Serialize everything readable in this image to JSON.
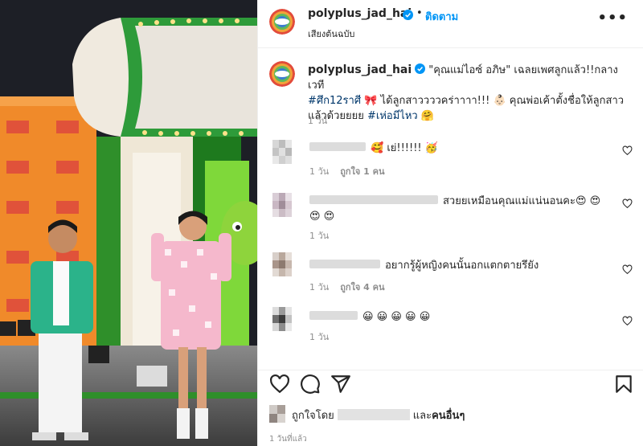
{
  "post": {
    "username": "polyplus_jad_hai",
    "separator": "•",
    "follow_label": "ติดตาม",
    "audio_label": "เสียงต้นฉบับ",
    "more_label": "•••"
  },
  "caption": {
    "username": "polyplus_jad_hai",
    "text_1": " \"คุณแม่ไอซ์ อภิษ\" เฉลยเพศลูกแล้ว!!กลางเวที",
    "hashtag_1": "#ศึก12ราศี",
    "text_2": " 🎀  ได้ลูกสาววววคร่าาาา!!! 👶🏻 คุณพ่อเค้าตั้งชื่อให้ลูกสาว",
    "text_3": "แล้วด้วยยยย ",
    "hashtag_2": "#เห่อมีไหว",
    "text_4": " 🤗",
    "time": "1 วัน"
  },
  "comments": [
    {
      "text": "🥰 เย่!!!!!! 🥳",
      "time": "1 วัน",
      "likes": "ถูกใจ 1 คน"
    },
    {
      "text": "สวยยเหมือนคุณแม่แน่นอนคะ😍 😍",
      "text_2": "😍 😍",
      "time": "1 วัน",
      "likes": ""
    },
    {
      "text": "อยากรู้ผู้หญิงคนนั้นอกแตกตายรึยัง",
      "time": "1 วัน",
      "likes": "ถูกใจ 4 คน"
    },
    {
      "text": "😀 😀 😀 😀 😀",
      "time": "1 วัน",
      "likes": ""
    }
  ],
  "footer": {
    "liked_by_prefix": "ถูกใจโดย",
    "liked_by_suffix_and": "และ",
    "liked_by_others": "คนอื่นๆ",
    "posted_time": "1 วันที่แล้ว"
  },
  "colors": {
    "accent": "#0095f6",
    "text": "#262626",
    "muted": "#8e8e8e",
    "hashtag": "#00376b"
  },
  "icons": [
    "verified-icon",
    "more-icon",
    "heart-icon",
    "comment-icon",
    "share-icon",
    "bookmark-icon"
  ]
}
